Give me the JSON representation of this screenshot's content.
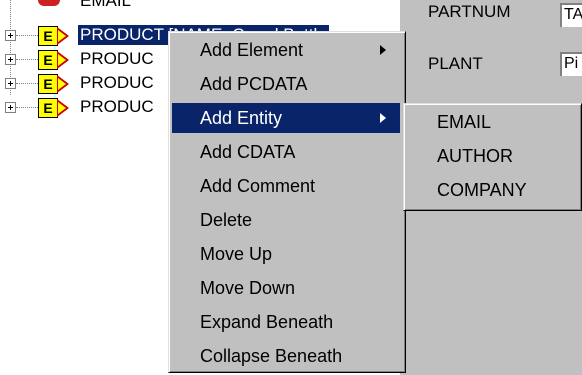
{
  "tree": {
    "top_partial": "EMAIL",
    "nodes": [
      {
        "badge": "E",
        "label": "PRODUCT [NAME=Creed Bottle",
        "selected": true
      },
      {
        "badge": "E",
        "label": "PRODUC",
        "selected": false
      },
      {
        "badge": "E",
        "label": "PRODUC",
        "selected": false
      },
      {
        "badge": "E",
        "label": "PRODUC",
        "selected": false
      }
    ]
  },
  "attributes": {
    "rows": [
      {
        "label": "PARTNUM",
        "value": "TA"
      },
      {
        "label": "PLANT",
        "value": "Pi"
      }
    ]
  },
  "context_menu": {
    "items": [
      {
        "label": "Add Element",
        "submenu": true
      },
      {
        "label": "Add PCDATA",
        "submenu": false
      },
      {
        "label": "Add Entity",
        "submenu": true,
        "active": true
      },
      {
        "label": "Add CDATA",
        "submenu": false
      },
      {
        "label": "Add Comment",
        "submenu": false
      },
      {
        "label": "Delete",
        "submenu": false
      },
      {
        "label": "Move Up",
        "submenu": false
      },
      {
        "label": "Move Down",
        "submenu": false
      },
      {
        "label": "Expand Beneath",
        "submenu": false
      },
      {
        "label": "Collapse Beneath",
        "submenu": false
      }
    ]
  },
  "entity_submenu": {
    "items": [
      "EMAIL",
      "AUTHOR",
      "COMPANY"
    ]
  },
  "colors": {
    "selection": "#0a246a",
    "menu_bg": "#c0c0c0",
    "badge": "#ffff00"
  }
}
